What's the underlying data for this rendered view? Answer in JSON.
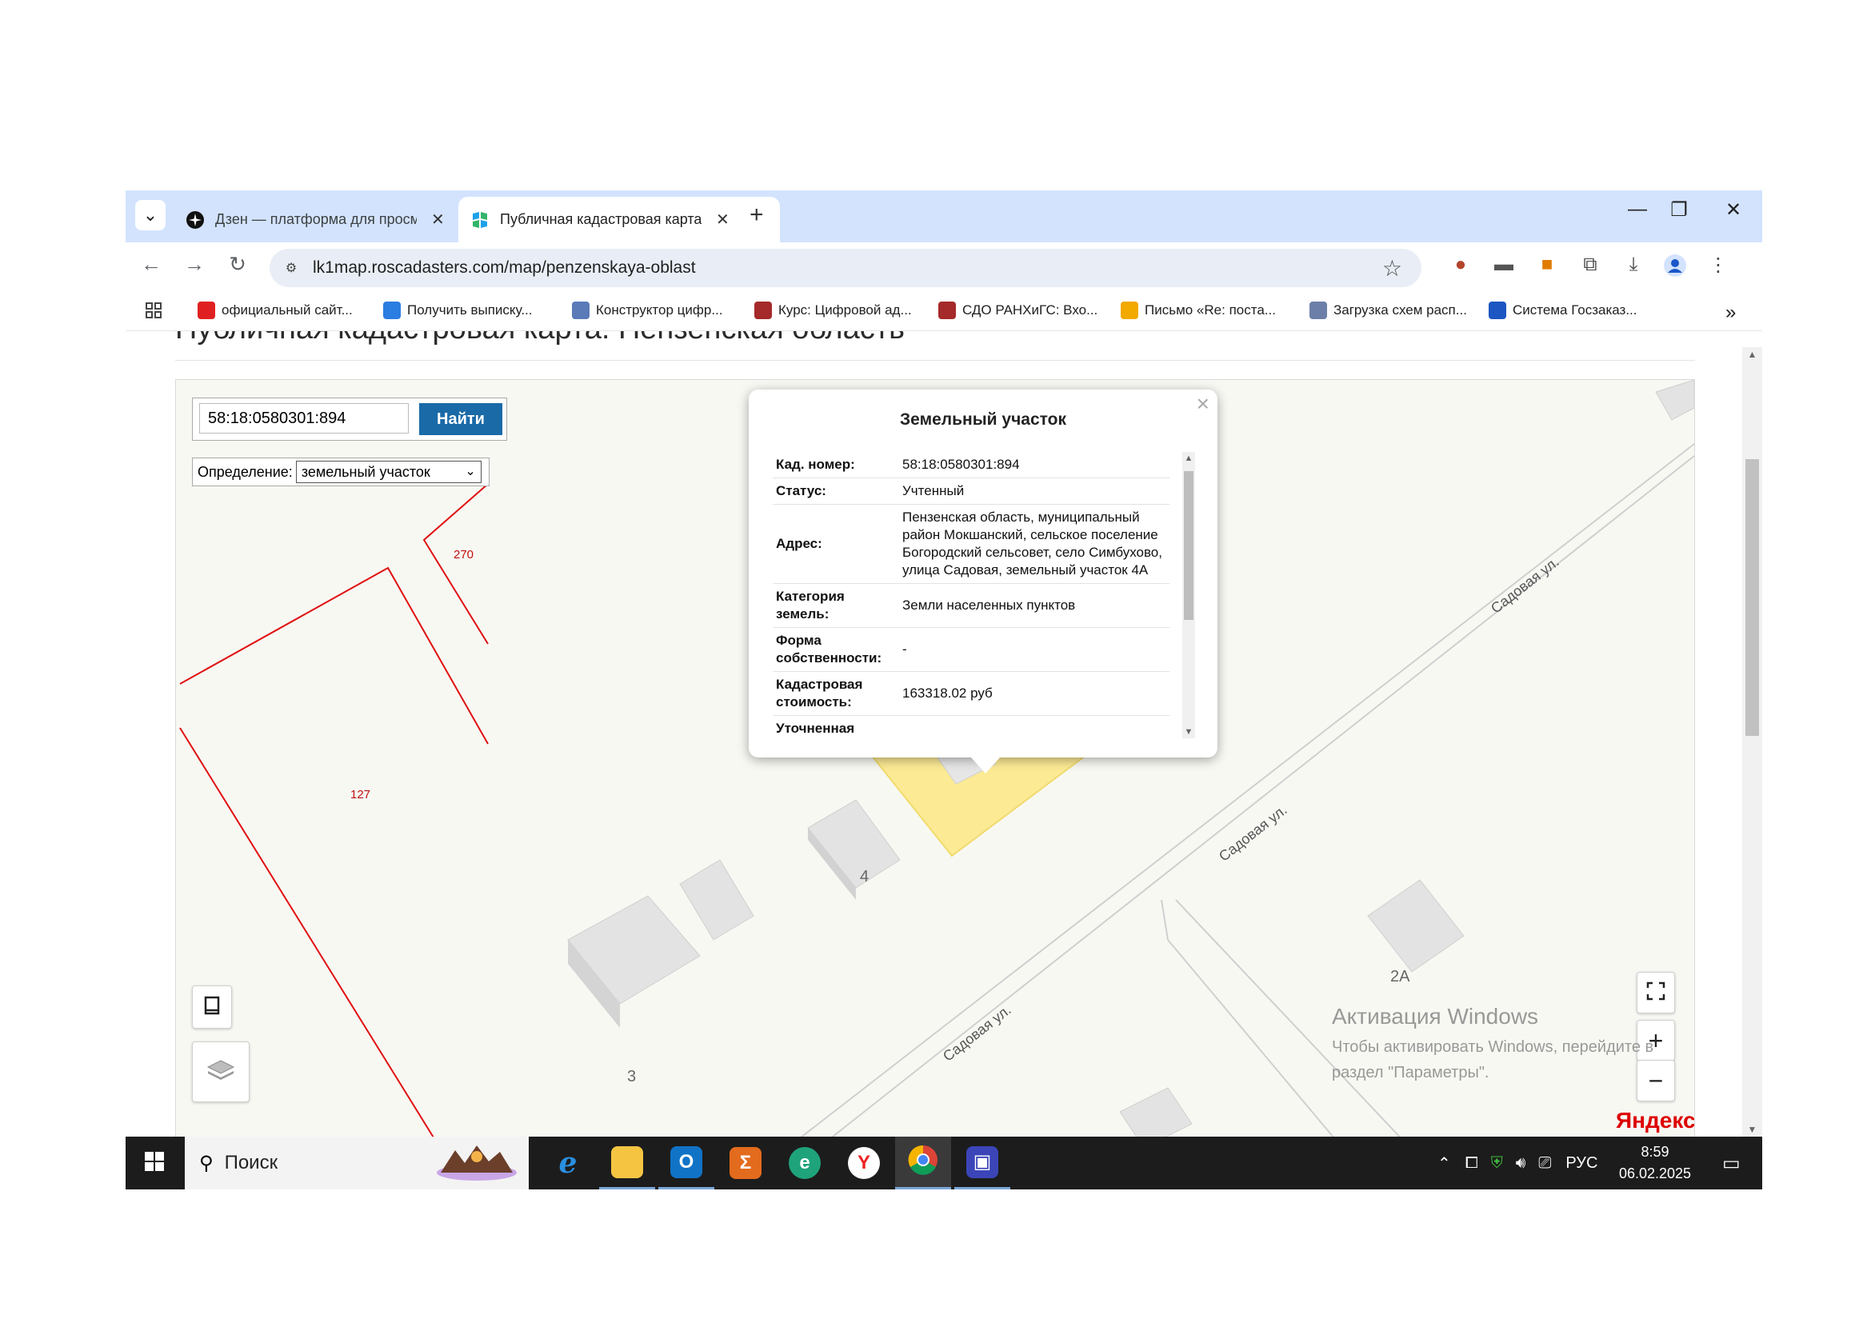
{
  "browser": {
    "tabs": [
      {
        "title": "Дзен — платформа для просмотра",
        "active": false
      },
      {
        "title": "Публичная кадастровая карта",
        "active": true
      }
    ],
    "url": "lk1map.roscadasters.com/map/penzenskaya-oblast",
    "bookmarks": [
      {
        "label": "официальный сайт...",
        "icon": "yandex-icon",
        "color": "#e02020"
      },
      {
        "label": "Получить выписку...",
        "icon": "leaf-icon",
        "color": "#2a7de1"
      },
      {
        "label": "Конструктор цифр...",
        "icon": "doc-icon",
        "color": "#5a7ab8"
      },
      {
        "label": "Курс: Цифровой ад...",
        "icon": "ranepa-icon",
        "color": "#a52a2a"
      },
      {
        "label": "СДО РАНХиГС: Вхо...",
        "icon": "ranepa-icon",
        "color": "#a52a2a"
      },
      {
        "label": "Письмо «Re: поста...",
        "icon": "mail-icon",
        "color": "#f2a900"
      },
      {
        "label": "Загрузка схем расп...",
        "icon": "doc-icon",
        "color": "#6b7fa8"
      },
      {
        "label": "Система Госзаказ...",
        "icon": "circle-icon",
        "color": "#1b56c2"
      }
    ]
  },
  "page": {
    "title": "Публичная кадастровая карта: Пензенская область"
  },
  "search": {
    "value": "58:18:0580301:894",
    "button": "Найти",
    "definition_label": "Определение:",
    "definition_value": "земельный участок"
  },
  "map_labels": {
    "parcel_270": "270",
    "parcel_127": "127",
    "house_4": "4",
    "house_3": "3",
    "house_2a": "2А",
    "street_1": "Садовая ул.",
    "street_2": "Садовая ул.",
    "street_3": "Садовая ул.",
    "yandex": "Яндекс"
  },
  "popup": {
    "title": "Земельный участок",
    "rows": [
      {
        "key": "Кад. номер:",
        "value": "58:18:0580301:894"
      },
      {
        "key": "Статус:",
        "value": "Учтенный"
      },
      {
        "key": "Адрес:",
        "value": "Пензенская область, муниципальный район Мокшанский, сельское поселение Богородский сельсовет, село Симбухово, улица Садовая, земельный участок 4А"
      },
      {
        "key": "Категория земель:",
        "value": "Земли населенных пунктов"
      },
      {
        "key": "Форма собственности:",
        "value": "-"
      },
      {
        "key": "Кадастровая стоимость:",
        "value": "163318.02 руб"
      },
      {
        "key": "Уточненная",
        "value": ""
      }
    ]
  },
  "windows_activation": {
    "title": "Активация Windows",
    "text": "Чтобы активировать Windows, перейдите в раздел \"Параметры\"."
  },
  "taskbar": {
    "search_label": "Поиск",
    "language": "РУС",
    "time": "8:59",
    "date": "06.02.2025",
    "apps": [
      "internet-explorer-icon",
      "file-explorer-icon",
      "outlook-icon",
      "sum-app-icon",
      "edge-icon",
      "yandex-browser-icon",
      "chrome-icon",
      "floppy-icon"
    ]
  },
  "colors": {
    "tabstrip": "#d3e3fd",
    "parcel_highlight": "#fde98a",
    "parcel_border": "#e01010",
    "search_button": "#1a6aa8"
  }
}
